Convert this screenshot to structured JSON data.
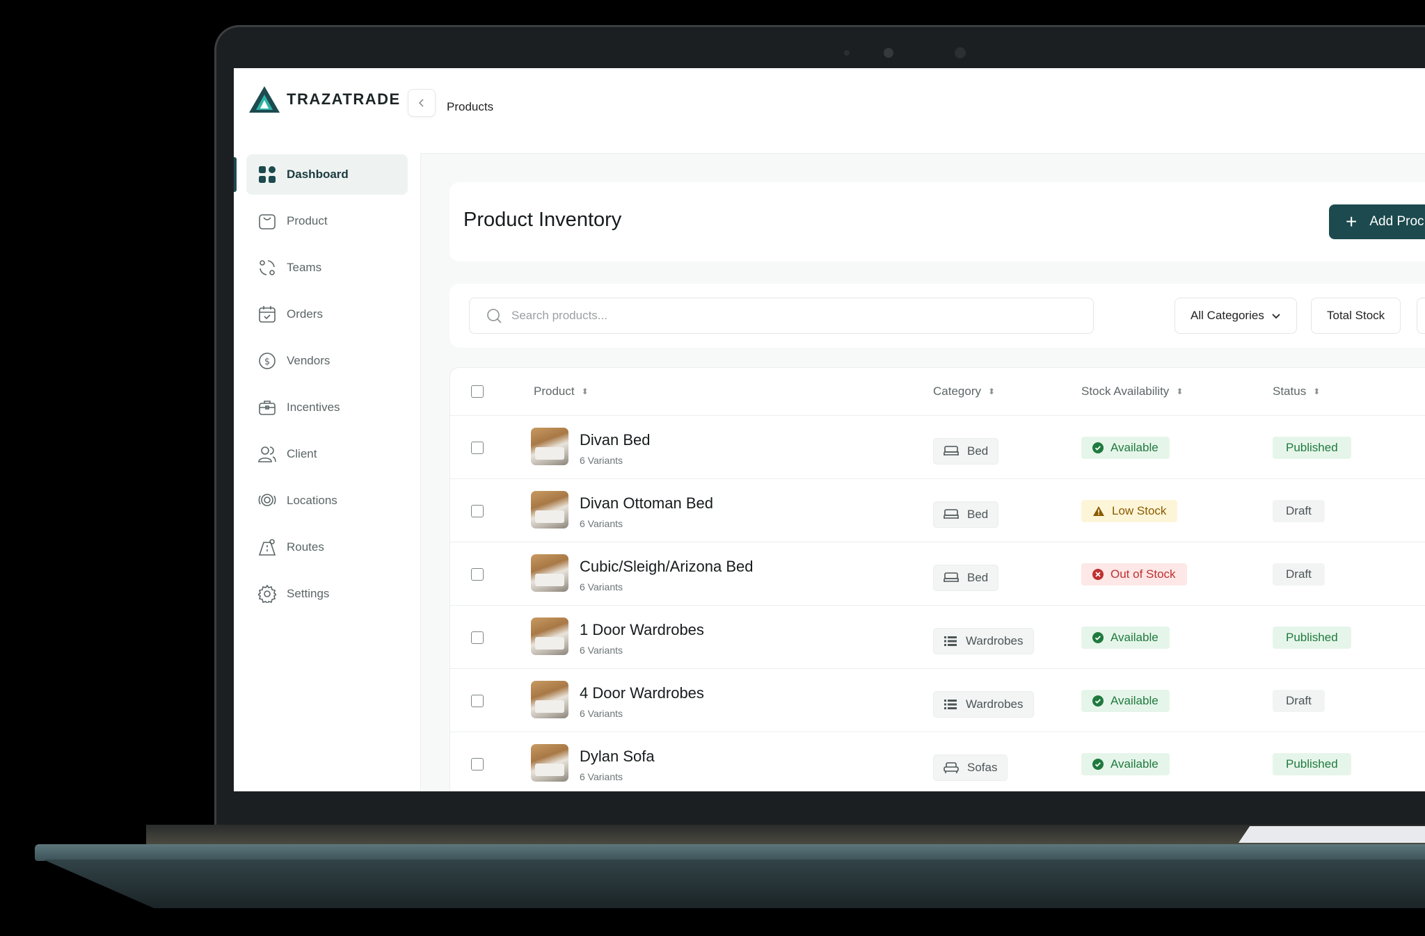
{
  "app": {
    "logo_text": "TRAZATRADE",
    "accent": "#1d4a4e"
  },
  "sidebar": {
    "items": [
      {
        "label": "Dashboard",
        "icon": "dashboard-grid-icon",
        "active": true
      },
      {
        "label": "Product",
        "icon": "shopping-bag-icon"
      },
      {
        "label": "Teams",
        "icon": "team-icon"
      },
      {
        "label": "Orders",
        "icon": "calendar-check-icon"
      },
      {
        "label": "Vendors",
        "icon": "dollar-circle-icon"
      },
      {
        "label": "Incentives",
        "icon": "briefcase-icon"
      },
      {
        "label": "Client",
        "icon": "users-icon"
      },
      {
        "label": "Locations",
        "icon": "location-icon"
      },
      {
        "label": "Routes",
        "icon": "route-icon"
      },
      {
        "label": "Settings",
        "icon": "gear-icon"
      }
    ]
  },
  "header": {
    "breadcrumb": "Products"
  },
  "main": {
    "title": "Product Inventory",
    "add_button_label": "Add Proc"
  },
  "filters": {
    "search_placeholder": "Search products...",
    "category_label": "All Categories",
    "stock_label": "Total Stock"
  },
  "table": {
    "columns": [
      "Product",
      "Category",
      "Stock Availability",
      "Status"
    ],
    "rows": [
      {
        "name": "Divan Bed",
        "variants": "6 Variants",
        "category": "Bed",
        "category_icon": "bed-icon",
        "stock": "Available",
        "stock_type": "available",
        "status": "Published"
      },
      {
        "name": "Divan Ottoman Bed",
        "variants": "6 Variants",
        "category": "Bed",
        "category_icon": "bed-icon",
        "stock": "Low Stock",
        "stock_type": "low",
        "status": "Draft"
      },
      {
        "name": "Cubic/Sleigh/Arizona Bed",
        "variants": "6 Variants",
        "category": "Bed",
        "category_icon": "bed-icon",
        "stock": "Out of Stock",
        "stock_type": "out",
        "status": "Draft"
      },
      {
        "name": "1 Door Wardrobes",
        "variants": "6 Variants",
        "category": "Wardrobes",
        "category_icon": "wardrobe-icon",
        "stock": "Available",
        "stock_type": "available",
        "status": "Published"
      },
      {
        "name": "4 Door Wardrobes",
        "variants": "6 Variants",
        "category": "Wardrobes",
        "category_icon": "wardrobe-icon",
        "stock": "Available",
        "stock_type": "available",
        "status": "Draft"
      },
      {
        "name": "Dylan Sofa",
        "variants": "6 Variants",
        "category": "Sofas",
        "category_icon": "sofa-icon",
        "stock": "Available",
        "stock_type": "available",
        "status": "Published"
      }
    ]
  },
  "colors": {
    "available_bg": "#e6f5ea",
    "available_fg": "#1f7a3e",
    "low_bg": "#fdf5d8",
    "low_fg": "#8a5a00",
    "out_bg": "#fde7e7",
    "out_fg": "#c03030",
    "published_bg": "#e6f5ea",
    "published_fg": "#1f7a3e",
    "draft_bg": "#f2f3f3",
    "draft_fg": "#4c5556"
  }
}
